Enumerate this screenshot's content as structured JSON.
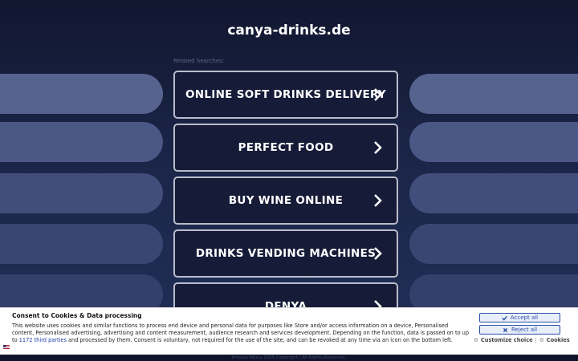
{
  "domain_title": "canya-drinks.de",
  "related_label": "Related Searches:",
  "related_searches": [
    "ONLINE SOFT DRINKS DELIVERY",
    "PERFECT FOOD",
    "BUY WINE ONLINE",
    "DRINKS VENDING MACHINES",
    "DENYA"
  ],
  "consent": {
    "title": "Consent to Cookies & Data processing",
    "text_before_link": "This website uses cookies and similar functions to process end device and personal data for purposes like Store and/or access information on a device, Personalised content, Personalised advertising, advertising and content measurement, audience research and services development. Depending on the function, data is passed on to up to ",
    "link": "1172 third parties",
    "text_after_link": " and processed by them. Consent is voluntary, not required for the use of the site, and can be revoked at any time via an icon on the bottom left.",
    "accept_label": "Accept all",
    "reject_label": "Reject all",
    "customize_label": "Customize choice",
    "separator": "|",
    "cookies_label": "Cookies"
  },
  "footer": {
    "privacy_label": "Privacy Policy",
    "copyright": "2025 Copyright | All Rights Reserved."
  },
  "colors": {
    "background": "#141a33",
    "button_border": "#b9bccb",
    "consent_accent": "#2a4ea8"
  },
  "icons": [
    "chevron-right-icon",
    "check-icon",
    "x-icon",
    "gear-icon",
    "flag-icon"
  ]
}
